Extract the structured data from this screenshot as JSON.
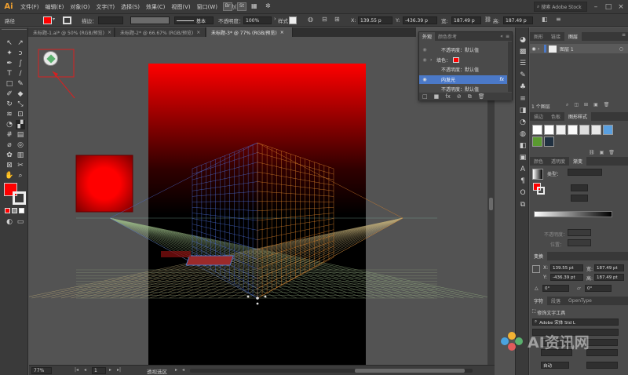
{
  "app": {
    "logo": "Ai"
  },
  "menu": [
    "文件(F)",
    "编辑(E)",
    "对象(O)",
    "文字(T)",
    "选择(S)",
    "效果(C)",
    "视图(V)",
    "窗口(W)",
    "帮助(H)"
  ],
  "menubar_right": {
    "st": "St",
    "search_placeholder": "搜索 Adobe Stock"
  },
  "control": {
    "path_label": "路径",
    "stroke_label": "描边：",
    "profile": "基本",
    "opacity_label": "不透明度：",
    "opacity_value": "100%",
    "style_label": "样式：",
    "x_value": "139.55 p",
    "y_value": "-436.39 p",
    "w_value": "187.49 p",
    "h_value": "187.49 p"
  },
  "tabs": [
    {
      "label": "未标题-1.ai* @ 50% (RGB/预览)",
      "close": "×"
    },
    {
      "label": "未标题-2* @ 66.67% (RGB/预览)",
      "close": "×"
    },
    {
      "label": "未标题-3* @ 77% (RGB/预览)",
      "close": "×"
    }
  ],
  "statusbar": {
    "zoom": "77%",
    "page": "1",
    "tool_hint": "透视选区"
  },
  "colors": {
    "accent": "#ff0000",
    "selection_blue": "#4b79c8",
    "panel_bg": "#4a4a4a",
    "ui_dark": "#3a3a3a"
  },
  "appearance": {
    "tabs": [
      "外观",
      "颜色参考"
    ],
    "rows": [
      {
        "label": "不透明度：默认值"
      },
      {
        "label": "填色："
      },
      {
        "label": "不透明度：默认值"
      },
      {
        "label": "内发光",
        "fx": "fx"
      },
      {
        "label": "不透明度：默认值"
      }
    ]
  },
  "layers": {
    "tabs": [
      "图形",
      "链接",
      "图层"
    ],
    "layer_name": "图层 1",
    "count": "1 个图层"
  },
  "swatches": {
    "tabs": [
      "描边",
      "色板",
      "图形样式"
    ]
  },
  "gradient": {
    "tabs": [
      "颜色",
      "透明度",
      "渐变"
    ],
    "type_label": "类型：",
    "opacity_label": "不透明度：",
    "position_label": "位置："
  },
  "transform": {
    "tab": "变换",
    "x": "139.55 pt",
    "y": "-436.39 pt",
    "w": "187.49 pt",
    "h": "187.49 pt",
    "x_label": "X:",
    "y_label": "Y:",
    "w_label": "宽:",
    "h_label": "高:",
    "angle": "0°",
    "shear": "0°"
  },
  "character": {
    "tabs": [
      "字符",
      "段落",
      "OpenType"
    ],
    "touch_tool": "修饰文字工具",
    "font": "Adobe 宋体 Std L",
    "auto": "自动"
  },
  "watermark": {
    "text": "AI资讯网"
  }
}
